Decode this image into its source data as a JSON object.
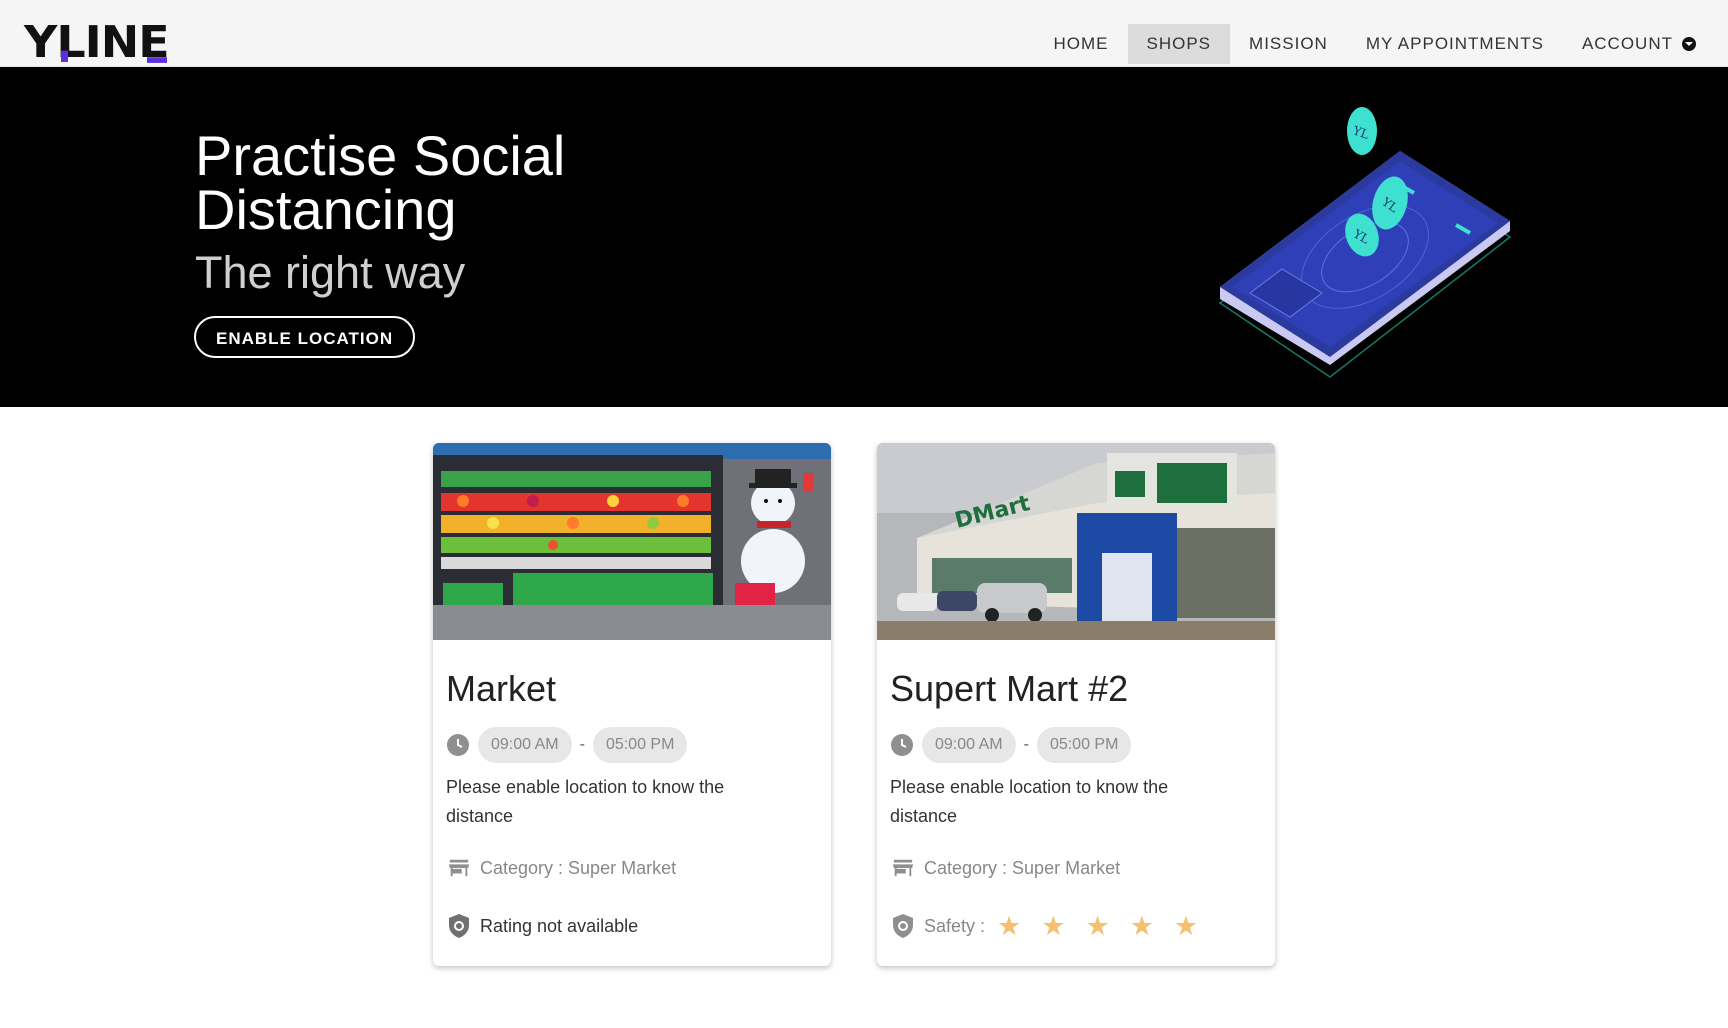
{
  "logo": {
    "text": "YLINE"
  },
  "nav": {
    "items": [
      "HOME",
      "SHOPS",
      "MISSION",
      "MY APPOINTMENTS"
    ],
    "active": "SHOPS",
    "account_label": "ACCOUNT",
    "account_icon": "account-dropdown-icon"
  },
  "hero": {
    "title": "Practise Social Distancing",
    "subtitle": "The right way",
    "button_label": "ENABLE LOCATION",
    "illustration": "phone-with-coins-illustration",
    "coin_label": "YL"
  },
  "colors": {
    "brand_accent": "#5b2ee0",
    "hero_bg": "#000000",
    "star": "#f4c171",
    "coin": "#3ee0d0",
    "phone": "#2b3a9e"
  },
  "shops": [
    {
      "name": "Market",
      "image": "fruit-market-stall-photo",
      "open": "09:00 AM",
      "close": "05:00 PM",
      "hours_separator": "-",
      "distance_text": "Please enable location to know the distance",
      "category_text": "Category : Super Market",
      "rating_text": "Rating not available"
    },
    {
      "name": "Supert Mart #2",
      "image": "dmart-storefront-photo",
      "open": "09:00 AM",
      "close": "05:00 PM",
      "hours_separator": "-",
      "distance_text": "Please enable location to know the distance",
      "category_text": "Category : Super Market",
      "safety_label": "Safety :",
      "safety_rating": 5,
      "safety_max": 5
    }
  ]
}
